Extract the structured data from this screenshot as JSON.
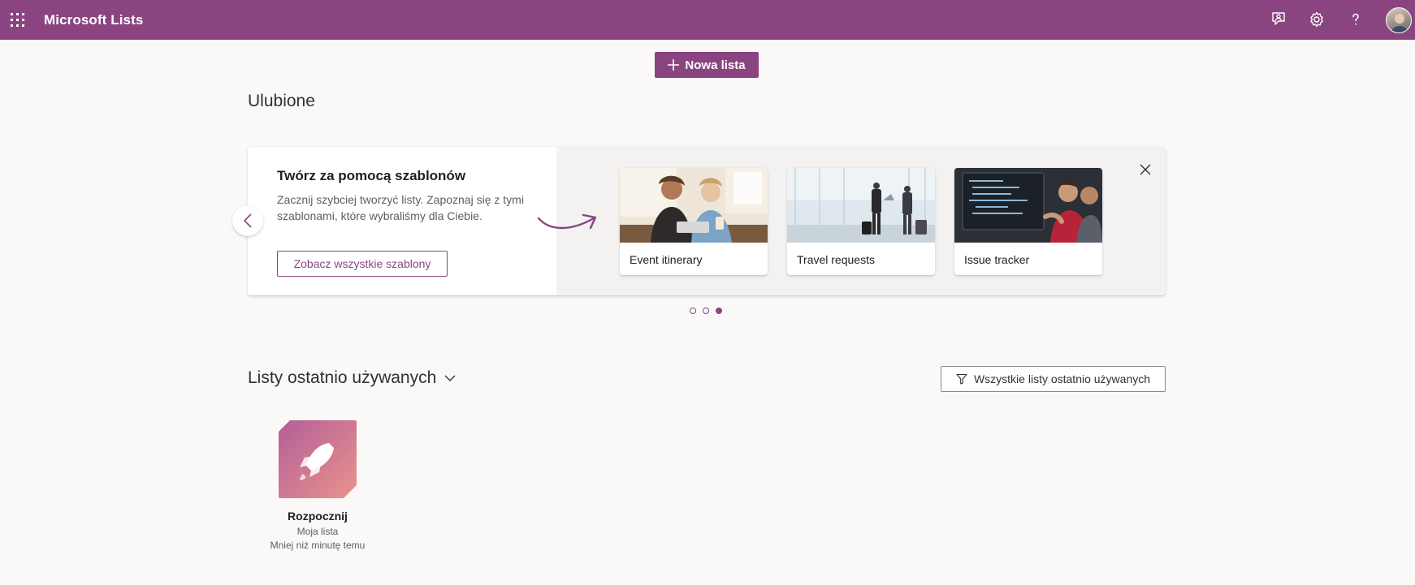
{
  "header": {
    "app_title": "Microsoft Lists",
    "icons": [
      "app-launcher-icon",
      "feedback-icon",
      "gear-icon",
      "help-icon",
      "profile-avatar"
    ]
  },
  "toolbar": {
    "new_list_label": "Nowa lista"
  },
  "favorites": {
    "title": "Ulubione"
  },
  "templates_banner": {
    "heading": "Twórz za pomocą szablonów",
    "description": "Zacznij szybciej tworzyć listy. Zapoznaj się z tymi szablonami, które wybraliśmy dla Ciebie.",
    "see_all_label": "Zobacz wszystkie szablony",
    "cards": [
      {
        "label": "Event itinerary"
      },
      {
        "label": "Travel requests"
      },
      {
        "label": "Issue tracker"
      }
    ],
    "pager": {
      "total": 3,
      "active_index": 2
    }
  },
  "recent": {
    "title": "Listy ostatnio używanych",
    "filter_label": "Wszystkie listy ostatnio używanych",
    "items": [
      {
        "name": "Rozpocznij",
        "location": "Moja lista",
        "modified": "Mniej niż minutę temu"
      }
    ]
  },
  "colors": {
    "brand": "#8a4581",
    "background": "#faf9f8",
    "list_icon_gradient": [
      "#b45e9a",
      "#e8948b"
    ]
  }
}
